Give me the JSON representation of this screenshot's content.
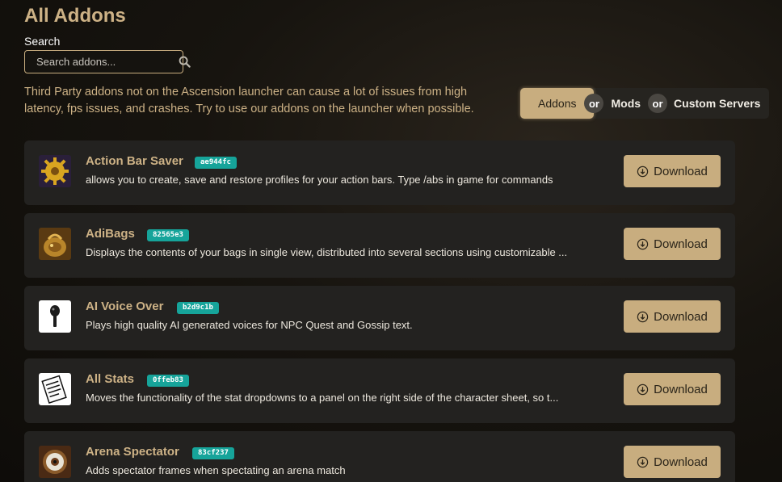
{
  "page": {
    "title": "All Addons"
  },
  "search": {
    "label": "Search",
    "placeholder": "Search addons...",
    "value": ""
  },
  "notice": "Third Party addons not on the Ascension launcher can cause a lot of issues from high latency, fps issues, and crashes. Try to use our addons on the launcher when possible.",
  "filters": {
    "options": [
      "Addons",
      "Mods",
      "Custom Servers"
    ],
    "active": "Addons",
    "separator": "or"
  },
  "colors": {
    "accent": "#c8ad7f",
    "badge": "#16a49a",
    "card": "#232220"
  },
  "addons": [
    {
      "name": "Action Bar Saver",
      "hash": "ae944fc",
      "description": "allows you to create, save and restore profiles for your action bars. Type /abs in game for commands",
      "download_label": "Download",
      "icon": "gear-icon"
    },
    {
      "name": "AdiBags",
      "hash": "82565e3",
      "description": "Displays the contents of your bags in single view, distributed into several sections using customizable ...",
      "download_label": "Download",
      "icon": "bag-icon"
    },
    {
      "name": "AI Voice Over",
      "hash": "b2d9c1b",
      "description": "Plays high quality AI generated voices for NPC Quest and Gossip text.",
      "download_label": "Download",
      "icon": "microphone-icon"
    },
    {
      "name": "All Stats",
      "hash": "0ffeb83",
      "description": "Moves the functionality of the stat dropdowns to a panel on the right side of the character sheet, so t...",
      "download_label": "Download",
      "icon": "stats-sheet-icon"
    },
    {
      "name": "Arena Spectator",
      "hash": "83cf237",
      "description": "Adds spectator frames when spectating an arena match",
      "download_label": "Download",
      "icon": "eye-icon"
    }
  ]
}
